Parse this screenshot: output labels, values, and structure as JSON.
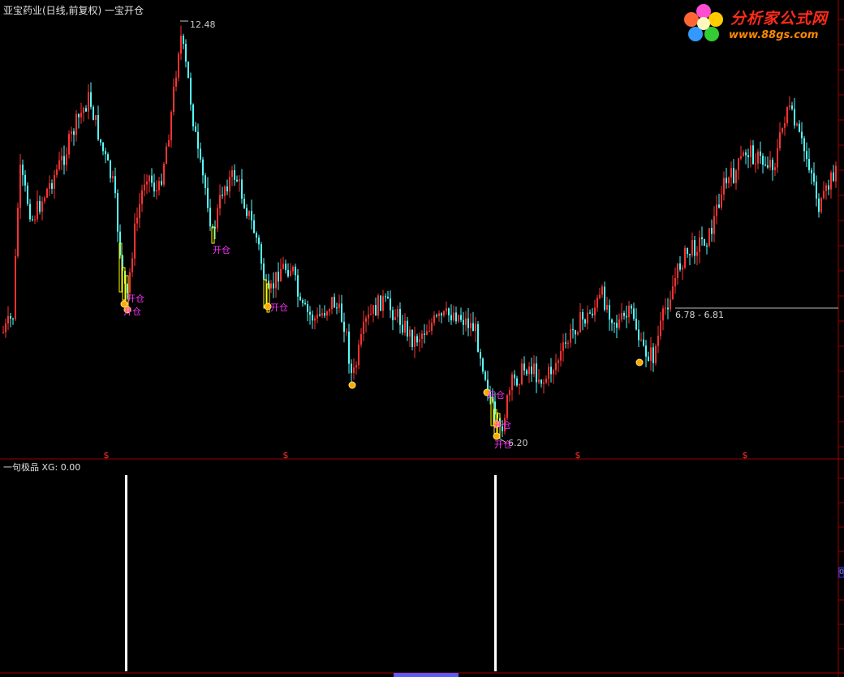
{
  "header": {
    "stock_title": "亚宝药业(日线,前复权) 一宝开仓"
  },
  "logo": {
    "brand": "分析家公式网",
    "url": "www.88gs.com",
    "icon": "flower-logo-icon"
  },
  "main_chart": {
    "high_label": "12.48",
    "low_label": "6.20",
    "cursor_range": "6.78 - 6.81",
    "signal_text": "开仓",
    "signal_labels": [
      {
        "label": "开仓"
      },
      {
        "label": "开仓"
      },
      {
        "label": "开仓"
      },
      {
        "label": "开仓"
      },
      {
        "label": "开仓"
      },
      {
        "label": "开仓"
      },
      {
        "label": "开仓"
      }
    ],
    "dividend_marker": "$",
    "colors": {
      "up": "#ff3232",
      "down": "#54fcfc",
      "signal": "#ffff00",
      "grid_tick": "#8b0000"
    }
  },
  "sub_chart": {
    "indicator_label": "一句极品  XG: 0.00",
    "right_value": "0",
    "signals": [
      {
        "label": "XG",
        "value": 1.0
      },
      {
        "label": "XG",
        "value": 1.0
      }
    ]
  }
}
